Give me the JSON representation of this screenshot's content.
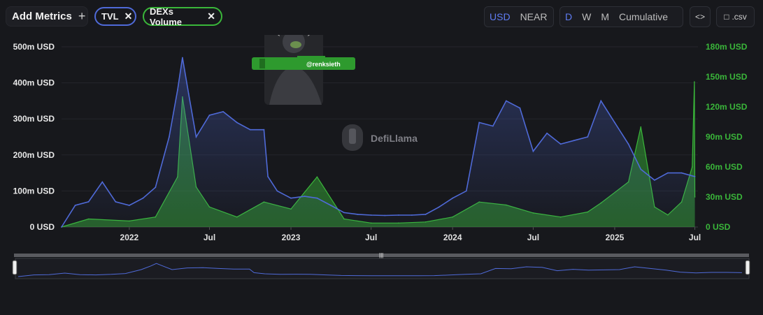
{
  "toolbar": {
    "add_metrics": "Add Metrics",
    "add_icon": "plus-icon",
    "chips": [
      {
        "label": "TVL",
        "color": "#4f6ad8"
      },
      {
        "label": "DEXs Volume",
        "color": "#3ab73a"
      }
    ],
    "currency": [
      "USD",
      "NEAR"
    ],
    "currency_active": "USD",
    "range": [
      "D",
      "W",
      "M",
      "Cumulative"
    ],
    "range_active": "D",
    "embed_icon": "code-icon",
    "csv_label": ".csv",
    "csv_icon": "file-icon"
  },
  "watermark": {
    "text": "DefiLlama",
    "sticker_handle": "@renksieth"
  },
  "colors": {
    "tvl": "#4f6ad8",
    "volume": "#3ab73a",
    "background": "#17181c"
  },
  "chart_data": {
    "type": "line",
    "x_ticks": [
      "2022",
      "Jul",
      "2023",
      "Jul",
      "2024",
      "Jul",
      "2025",
      "Jul"
    ],
    "y_left_ticks": [
      "0 USD",
      "100m USD",
      "200m USD",
      "300m USD",
      "400m USD",
      "500m USD"
    ],
    "y_right_ticks": [
      "0 USD",
      "30m USD",
      "60m USD",
      "90m USD",
      "120m USD",
      "150m USD",
      "180m USD"
    ],
    "y_left_range": [
      0,
      500
    ],
    "y_right_range": [
      0,
      180
    ],
    "series": [
      {
        "name": "TVL",
        "axis": "left",
        "unit": "m USD",
        "points": [
          [
            "2021-08-01",
            0
          ],
          [
            "2021-09-01",
            60
          ],
          [
            "2021-10-01",
            70
          ],
          [
            "2021-11-01",
            125
          ],
          [
            "2021-12-01",
            70
          ],
          [
            "2022-01-01",
            60
          ],
          [
            "2022-02-01",
            80
          ],
          [
            "2022-03-01",
            110
          ],
          [
            "2022-04-01",
            250
          ],
          [
            "2022-04-20",
            380
          ],
          [
            "2022-05-01",
            470
          ],
          [
            "2022-05-15",
            370
          ],
          [
            "2022-06-01",
            250
          ],
          [
            "2022-07-01",
            310
          ],
          [
            "2022-08-01",
            320
          ],
          [
            "2022-09-01",
            290
          ],
          [
            "2022-10-01",
            270
          ],
          [
            "2022-11-01",
            270
          ],
          [
            "2022-11-10",
            140
          ],
          [
            "2022-12-01",
            100
          ],
          [
            "2023-01-01",
            80
          ],
          [
            "2023-02-01",
            85
          ],
          [
            "2023-03-01",
            80
          ],
          [
            "2023-04-01",
            60
          ],
          [
            "2023-05-01",
            40
          ],
          [
            "2023-06-01",
            35
          ],
          [
            "2023-07-01",
            33
          ],
          [
            "2023-08-01",
            32
          ],
          [
            "2023-09-01",
            33
          ],
          [
            "2023-10-01",
            33
          ],
          [
            "2023-11-01",
            35
          ],
          [
            "2023-12-01",
            55
          ],
          [
            "2024-01-01",
            80
          ],
          [
            "2024-02-01",
            100
          ],
          [
            "2024-03-01",
            290
          ],
          [
            "2024-04-01",
            280
          ],
          [
            "2024-05-01",
            350
          ],
          [
            "2024-06-01",
            330
          ],
          [
            "2024-07-01",
            210
          ],
          [
            "2024-08-01",
            260
          ],
          [
            "2024-09-01",
            230
          ],
          [
            "2024-10-01",
            240
          ],
          [
            "2024-11-01",
            250
          ],
          [
            "2024-12-01",
            350
          ],
          [
            "2025-01-01",
            290
          ],
          [
            "2025-02-01",
            230
          ],
          [
            "2025-03-01",
            160
          ],
          [
            "2025-04-01",
            130
          ],
          [
            "2025-05-01",
            150
          ],
          [
            "2025-06-01",
            150
          ],
          [
            "2025-07-01",
            140
          ]
        ]
      },
      {
        "name": "DEXs Volume",
        "axis": "right",
        "unit": "m USD",
        "points": [
          [
            "2021-08-01",
            0
          ],
          [
            "2021-10-01",
            8
          ],
          [
            "2022-01-01",
            6
          ],
          [
            "2022-03-01",
            10
          ],
          [
            "2022-04-20",
            50
          ],
          [
            "2022-05-01",
            130
          ],
          [
            "2022-06-01",
            40
          ],
          [
            "2022-07-01",
            20
          ],
          [
            "2022-09-01",
            10
          ],
          [
            "2022-11-01",
            25
          ],
          [
            "2023-01-01",
            18
          ],
          [
            "2023-03-01",
            50
          ],
          [
            "2023-05-01",
            8
          ],
          [
            "2023-07-01",
            4
          ],
          [
            "2023-09-01",
            4
          ],
          [
            "2023-11-01",
            5
          ],
          [
            "2024-01-01",
            10
          ],
          [
            "2024-03-01",
            25
          ],
          [
            "2024-05-01",
            22
          ],
          [
            "2024-07-01",
            14
          ],
          [
            "2024-09-01",
            10
          ],
          [
            "2024-11-01",
            15
          ],
          [
            "2024-12-01",
            24
          ],
          [
            "2025-02-01",
            45
          ],
          [
            "2025-03-01",
            100
          ],
          [
            "2025-04-01",
            20
          ],
          [
            "2025-05-01",
            12
          ],
          [
            "2025-06-01",
            25
          ],
          [
            "2025-06-25",
            60
          ],
          [
            "2025-06-30",
            145
          ],
          [
            "2025-07-01",
            30
          ]
        ]
      }
    ]
  }
}
